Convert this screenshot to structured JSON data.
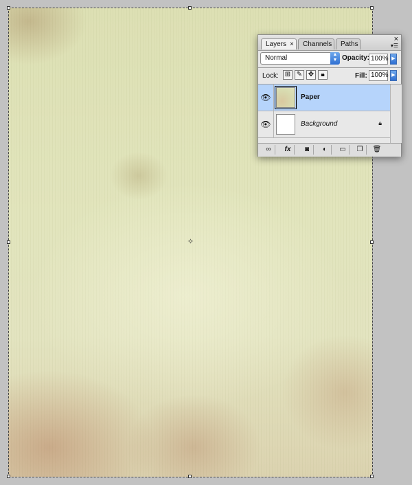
{
  "layers_panel": {
    "tabs": [
      {
        "label": "Layers",
        "close_glyph": "×"
      },
      {
        "label": "Channels"
      },
      {
        "label": "Paths"
      }
    ],
    "blend_mode": "Normal",
    "opacity_label": "Opacity:",
    "opacity_value": "100%",
    "lock_label": "Lock:",
    "fill_label": "Fill:",
    "fill_value": "100%",
    "layers": [
      {
        "name": "Paper",
        "selected": true,
        "visible": true
      },
      {
        "name": "Background",
        "selected": false,
        "visible": true,
        "locked": true
      }
    ],
    "bottom_buttons": [
      "link-icon",
      "fx-icon",
      "mask-icon",
      "adjustment-icon",
      "group-folder-icon",
      "new-layer-icon",
      "trash-icon"
    ],
    "fx_label": "fx"
  }
}
